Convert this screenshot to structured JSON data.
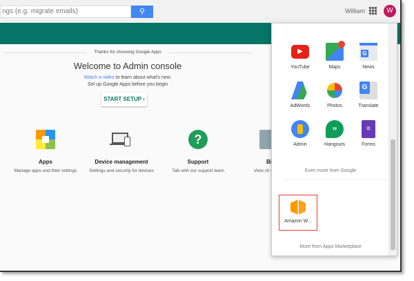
{
  "header": {
    "search_placeholder": "ngs (e.g. migrate emails)",
    "user_name": "William",
    "avatar_initial": "W"
  },
  "welcome": {
    "thanks": "Thanks for choosing Google Apps",
    "title": "Welcome to Admin console",
    "watch_link": "Watch a video",
    "watch_rest": " to learn about what's new.",
    "setup_line": "Set up Google Apps before you begin",
    "start_setup": "START SETUP ›"
  },
  "tiles": [
    {
      "title": "Apps",
      "desc": "Manage apps and their settings"
    },
    {
      "title": "Device management",
      "desc": "Settings and security for devices"
    },
    {
      "title": "Support",
      "desc": "Talk with our support team"
    },
    {
      "title": "Bi",
      "desc": "View ch manag"
    }
  ],
  "apps_panel": {
    "apps": [
      {
        "label": "YouTube"
      },
      {
        "label": "Maps"
      },
      {
        "label": "News"
      },
      {
        "label": "AdWords"
      },
      {
        "label": "Photos"
      },
      {
        "label": "Translate"
      },
      {
        "label": "Admin"
      },
      {
        "label": "Hangouts"
      },
      {
        "label": "Forms"
      }
    ],
    "even_more": "Even more from Google",
    "marketplace_app": "Amazon W...",
    "more_marketplace": "More from Apps Marketplace"
  },
  "colors": {
    "teal": "#047566",
    "blue": "#4285f4",
    "avatar": "#c2185b",
    "highlight": "#e53935"
  }
}
